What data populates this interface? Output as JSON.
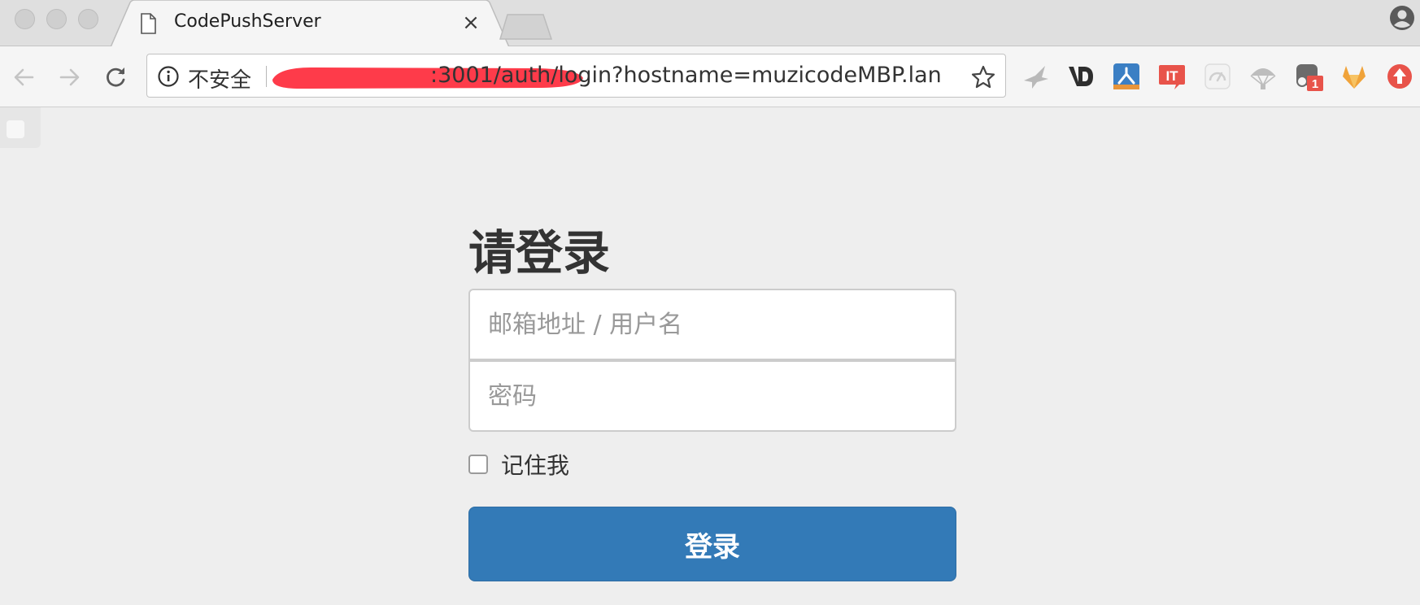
{
  "browser": {
    "tab_title": "CodePushServer",
    "tab_close_glyph": "×",
    "security_label": "不安全",
    "url_visible": ":3001/auth/login?hostname=muzicodeMBP.lan",
    "redaction_color": "#fe3b4a",
    "extension_badge": "1",
    "icons": [
      "back-icon",
      "forward-icon",
      "reload-icon",
      "info-icon",
      "star-icon",
      "profile-icon"
    ]
  },
  "login": {
    "title": "请登录",
    "username_placeholder": "邮箱地址 / 用户名",
    "password_placeholder": "密码",
    "remember_label": "记住我",
    "remember_checked": false,
    "submit_label": "登录",
    "button_color": "#337ab7"
  }
}
